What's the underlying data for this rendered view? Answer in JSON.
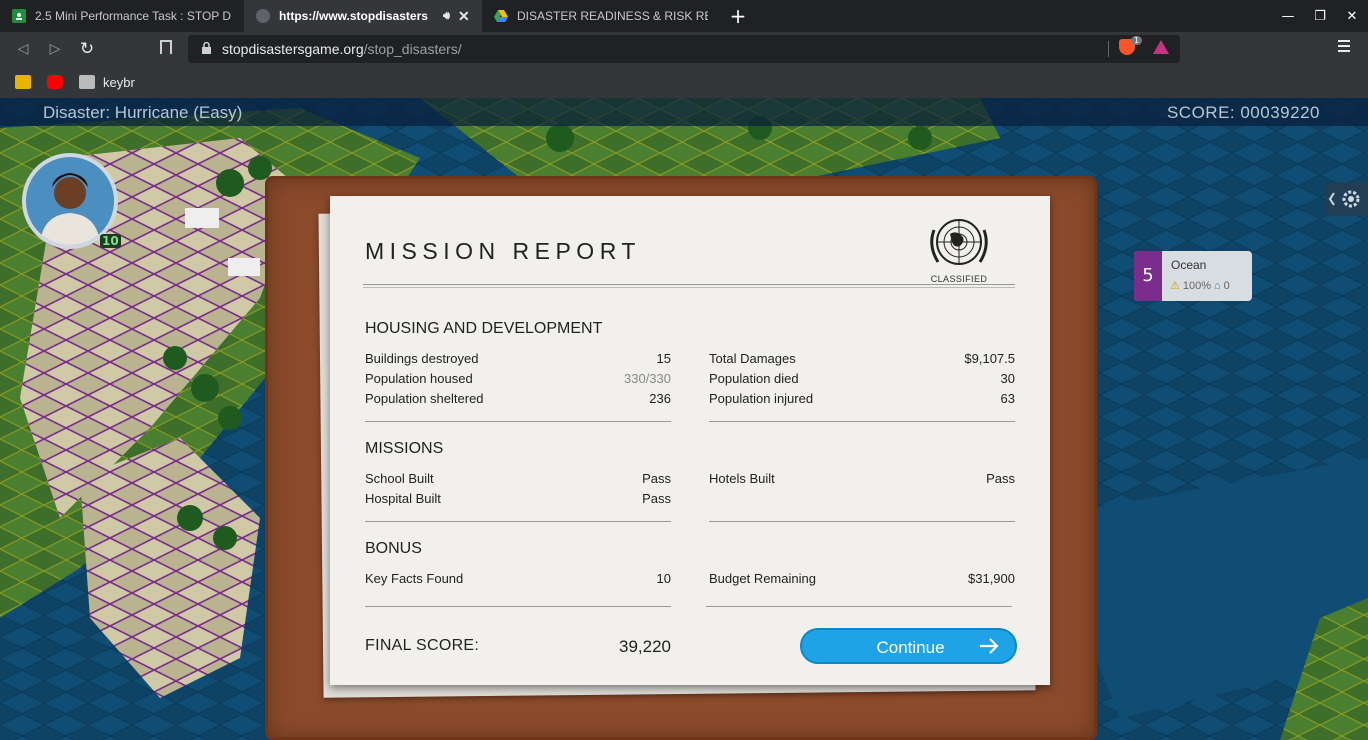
{
  "browser": {
    "tabs": [
      {
        "title": "2.5 Mini Performance Task : STOP D",
        "favicon": "classroom-icon",
        "active": false
      },
      {
        "title": "https://www.stopdisasters",
        "favicon": "globe-icon",
        "active": true
      },
      {
        "title": "DISASTER READINESS & RISK REDU",
        "favicon": "drive-icon",
        "active": false
      }
    ],
    "url_host": "stopdisastersgame.org",
    "url_path": "/stop_disasters/",
    "brave_badge": "1",
    "bookmarks": [
      {
        "label": "",
        "icon": "classroom-icon"
      },
      {
        "label": "",
        "icon": "youtube-icon"
      },
      {
        "label": "keybr",
        "icon": "keybr-icon"
      }
    ]
  },
  "game": {
    "disaster": "Disaster: Hurricane (Easy)",
    "score": "SCORE:  00039220",
    "avatar_badge": "10",
    "ocean_card": {
      "number": "5",
      "title": "Ocean",
      "percent": "100%",
      "count": "0"
    }
  },
  "report": {
    "title": "MISSION REPORT",
    "classified": "CLASSIFIED",
    "housing": {
      "heading": "HOUSING AND DEVELOPMENT",
      "left": [
        {
          "label": "Buildings destroyed",
          "value": "15"
        },
        {
          "label": "Population housed",
          "value": "330/330"
        },
        {
          "label": "Population sheltered",
          "value": "236"
        }
      ],
      "right": [
        {
          "label": "Total Damages",
          "value": "$9,107.5"
        },
        {
          "label": "Population died",
          "value": "30"
        },
        {
          "label": "Population injured",
          "value": "63"
        }
      ]
    },
    "missions": {
      "heading": "MISSIONS",
      "left": [
        {
          "label": "School Built",
          "value": "Pass"
        },
        {
          "label": "Hospital Built",
          "value": "Pass"
        }
      ],
      "right": [
        {
          "label": "Hotels Built",
          "value": "Pass"
        }
      ]
    },
    "bonus": {
      "heading": "BONUS",
      "left": [
        {
          "label": "Key Facts Found",
          "value": "10"
        }
      ],
      "right": [
        {
          "label": "Budget Remaining",
          "value": "$31,900"
        }
      ]
    },
    "final_label": "FINAL SCORE:",
    "final_score": "39,220",
    "continue_label": "Continue"
  },
  "colors": {
    "accent": "#1ea4e6",
    "board": "#8b4a2a",
    "paper": "#f1f0ec"
  }
}
